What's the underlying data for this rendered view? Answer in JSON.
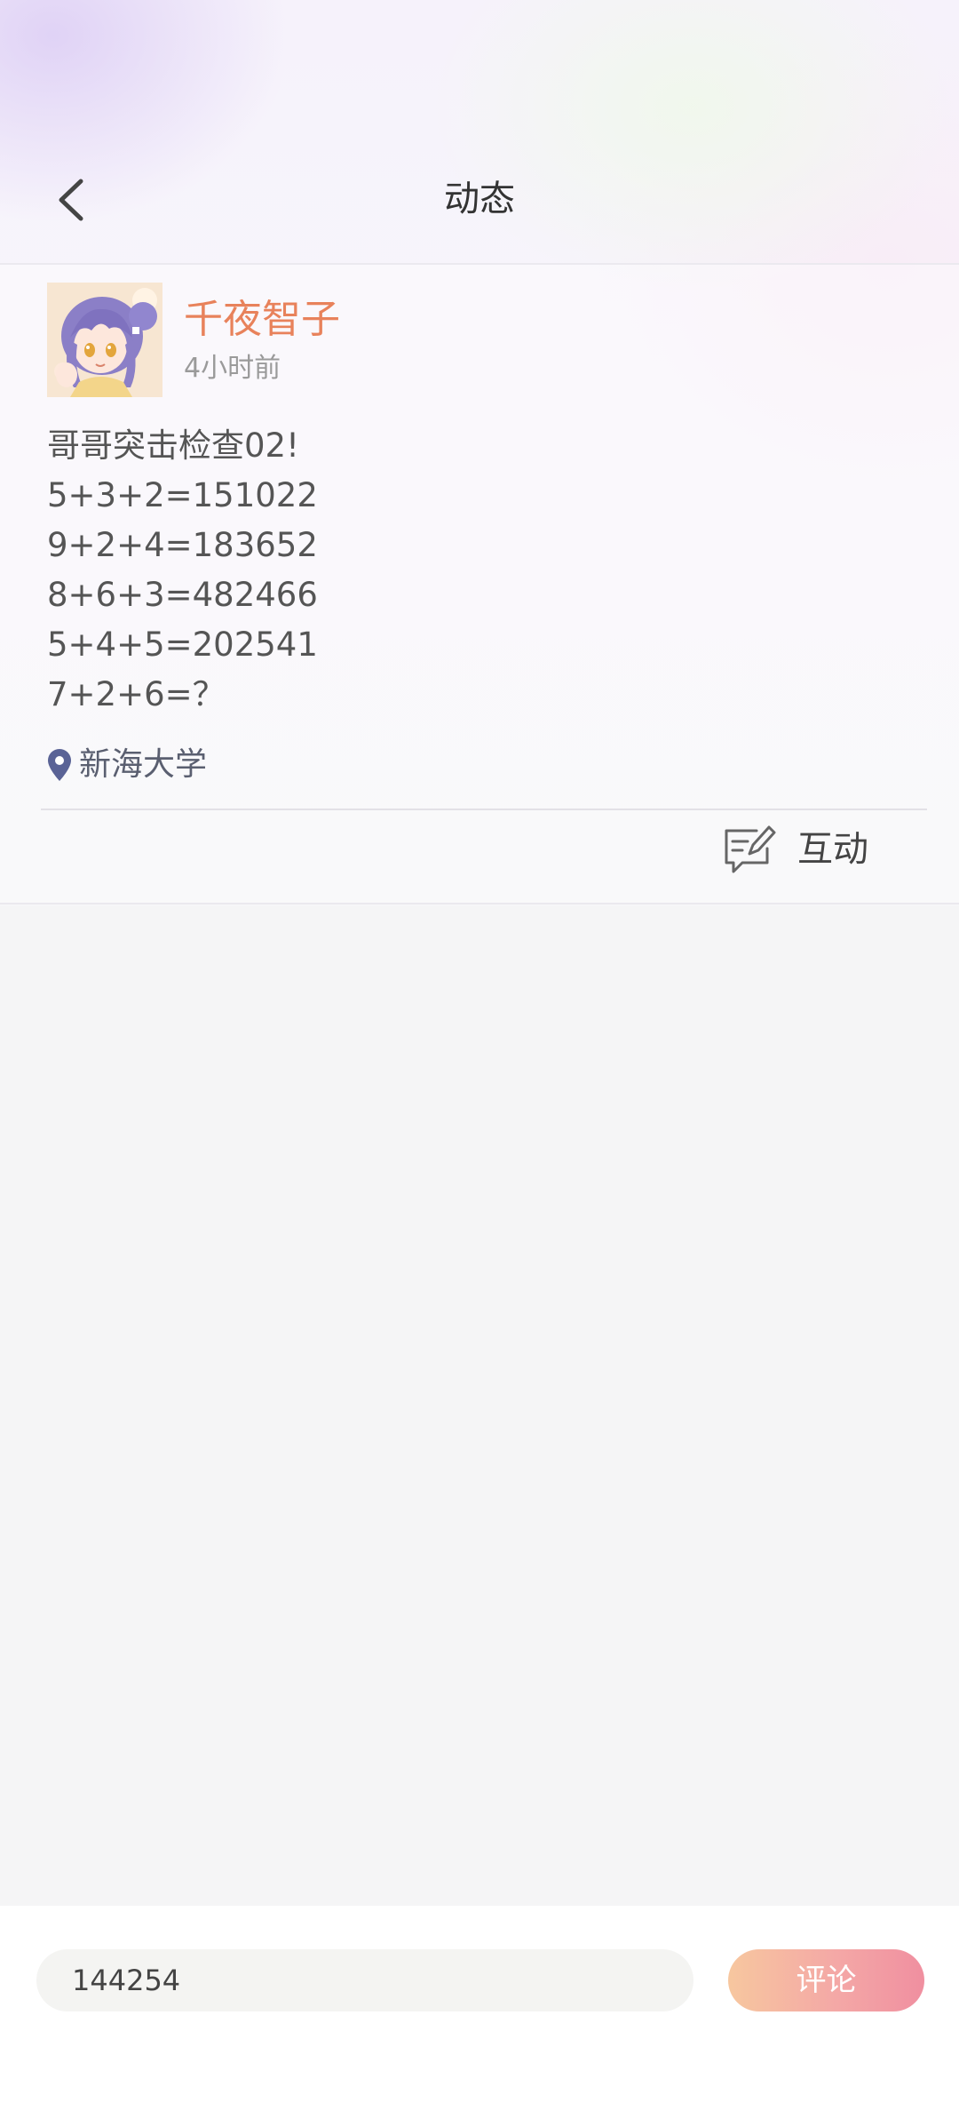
{
  "header": {
    "title": "动态",
    "back_icon": "chevron-left-icon"
  },
  "post": {
    "author": "千夜智子",
    "time": "4小时前",
    "lines": [
      "哥哥突击检查02!",
      "5+3+2=151022",
      "9+2+4=183652",
      "8+6+3=482466",
      "5+4+5=202541",
      "7+2+6=？"
    ],
    "location": "新海大学",
    "location_icon": "map-pin-icon",
    "interact_label": "互动",
    "interact_icon": "comment-edit-icon"
  },
  "comment_bar": {
    "input_value": "144254",
    "button_label": "评论"
  },
  "colors": {
    "author_name": "#e8825b",
    "location_icon": "#5a6396",
    "button_gradient_start": "#f7c79f",
    "button_gradient_end": "#f08fa0"
  }
}
